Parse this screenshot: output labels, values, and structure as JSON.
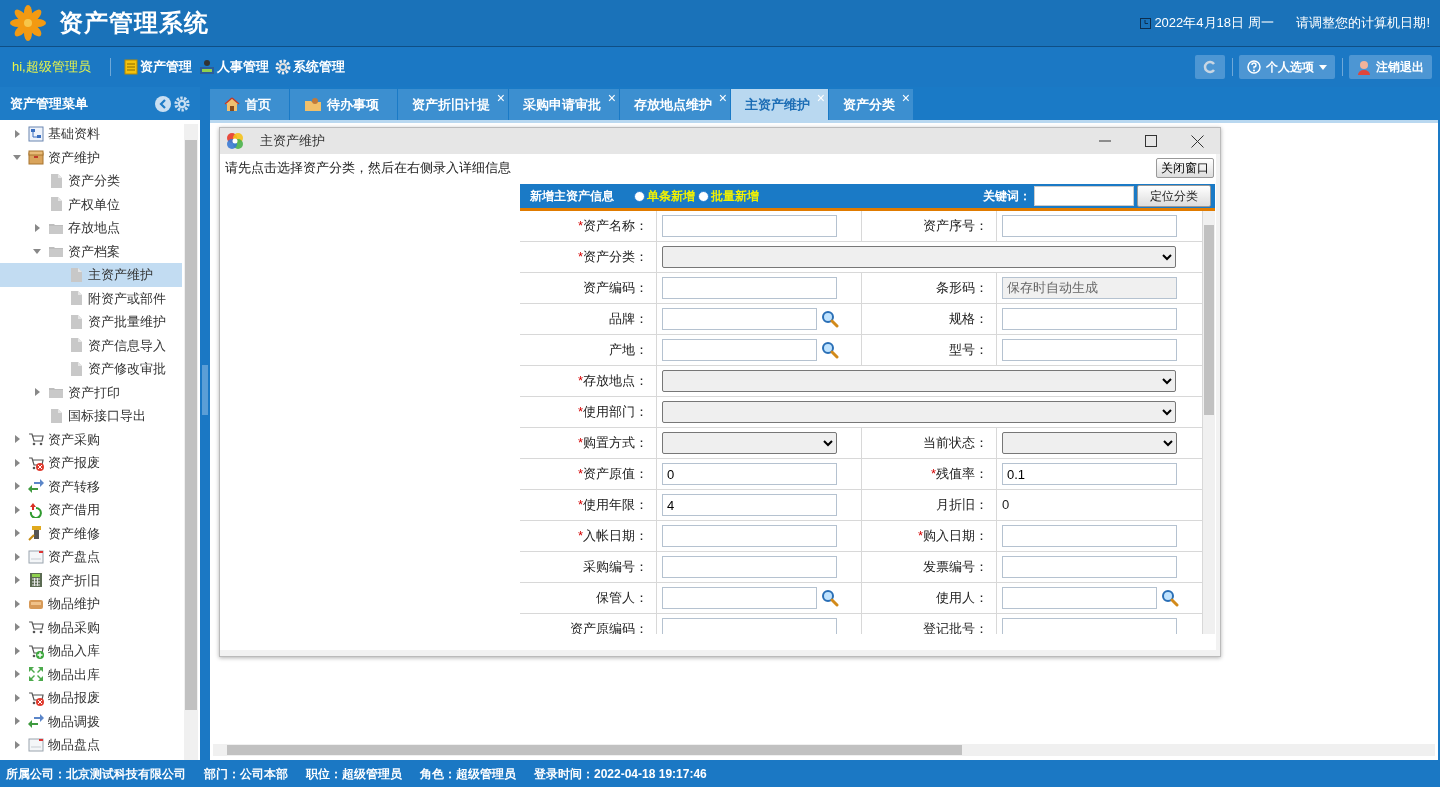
{
  "header": {
    "title": "资产管理系统",
    "date": "2022年4月18日 周一",
    "notice": "请调整您的计算机日期!"
  },
  "navbar": {
    "greeting": "hi,超级管理员",
    "menus": [
      "资产管理",
      "人事管理",
      "系统管理"
    ],
    "options": "个人选项",
    "logout": "注销退出"
  },
  "sidebar": {
    "title": "资产管理菜单",
    "items": [
      {
        "label": "基础资料",
        "expanded": false,
        "selected": false
      },
      {
        "label": "资产维护",
        "expanded": true,
        "selected": false,
        "children": [
          {
            "label": "资产分类",
            "selected": false
          },
          {
            "label": "产权单位",
            "selected": false
          },
          {
            "label": "存放地点",
            "expanded": false,
            "selected": false
          },
          {
            "label": "资产档案",
            "expanded": true,
            "selected": false,
            "children": [
              {
                "label": "主资产维护",
                "selected": true
              },
              {
                "label": "附资产或部件",
                "selected": false
              },
              {
                "label": "资产批量维护",
                "selected": false
              },
              {
                "label": "资产信息导入",
                "selected": false
              },
              {
                "label": "资产修改审批",
                "selected": false
              }
            ]
          },
          {
            "label": "资产打印",
            "expanded": false,
            "selected": false
          },
          {
            "label": "国标接口导出",
            "selected": false
          }
        ]
      },
      {
        "label": "资产采购",
        "expanded": false,
        "selected": false
      },
      {
        "label": "资产报废",
        "expanded": false,
        "selected": false
      },
      {
        "label": "资产转移",
        "expanded": false,
        "selected": false
      },
      {
        "label": "资产借用",
        "expanded": false,
        "selected": false
      },
      {
        "label": "资产维修",
        "expanded": false,
        "selected": false
      },
      {
        "label": "资产盘点",
        "expanded": false,
        "selected": false
      },
      {
        "label": "资产折旧",
        "expanded": false,
        "selected": false
      },
      {
        "label": "物品维护",
        "expanded": false,
        "selected": false
      },
      {
        "label": "物品采购",
        "expanded": false,
        "selected": false
      },
      {
        "label": "物品入库",
        "expanded": false,
        "selected": false
      },
      {
        "label": "物品出库",
        "expanded": false,
        "selected": false
      },
      {
        "label": "物品报废",
        "expanded": false,
        "selected": false
      },
      {
        "label": "物品调拨",
        "expanded": false,
        "selected": false
      },
      {
        "label": "物品盘点",
        "expanded": false,
        "selected": false
      }
    ]
  },
  "tabs": [
    {
      "label": "首页",
      "selected": false
    },
    {
      "label": "待办事项",
      "selected": false
    },
    {
      "label": "资产折旧计提",
      "selected": false,
      "close": "×"
    },
    {
      "label": "采购申请审批",
      "selected": false,
      "close": "×"
    },
    {
      "label": "存放地点维护",
      "selected": false,
      "close": "×"
    },
    {
      "label": "主资产维护",
      "selected": true,
      "close": "×"
    },
    {
      "label": "资产分类",
      "selected": false,
      "close": "×"
    }
  ],
  "dialog": {
    "title": "主资产维护",
    "hint": "请先点击选择资产分类，然后在右侧录入详细信息",
    "close_button": "关闭窗口",
    "form": {
      "title": "新增主资产信息",
      "modes": [
        {
          "label": "单条新增",
          "selected": false
        },
        {
          "label": "批量新增",
          "selected": false
        }
      ],
      "keyword_label": "关键词：",
      "locate_button": "定位分类",
      "rows": [
        {
          "kind": "pair",
          "cells": [
            {
              "mark": "*",
              "label": "资产名称：",
              "kind": "text"
            },
            {
              "label": "资产序号：",
              "kind": "text"
            }
          ]
        },
        {
          "kind": "full",
          "cells": [
            {
              "mark": "*",
              "label": "资产分类：",
              "kind": "select"
            }
          ]
        },
        {
          "kind": "pair",
          "cells": [
            {
              "label": "资产编码：",
              "kind": "text"
            },
            {
              "label": "条形码：",
              "kind": "readonly",
              "value": "保存时自动生成"
            }
          ]
        },
        {
          "kind": "pair",
          "cells": [
            {
              "label": "品牌：",
              "kind": "lookup"
            },
            {
              "label": "规格：",
              "kind": "text"
            }
          ]
        },
        {
          "kind": "pair",
          "cells": [
            {
              "label": "产地：",
              "kind": "lookup"
            },
            {
              "label": "型号：",
              "kind": "text"
            }
          ]
        },
        {
          "kind": "full",
          "cells": [
            {
              "mark": "*",
              "label": "存放地点：",
              "kind": "select"
            }
          ]
        },
        {
          "kind": "full",
          "cells": [
            {
              "mark": "*",
              "label": "使用部门：",
              "kind": "select"
            }
          ]
        },
        {
          "kind": "pair",
          "cells": [
            {
              "mark": "*",
              "label": "购置方式：",
              "kind": "select"
            },
            {
              "label": "当前状态：",
              "kind": "select"
            }
          ]
        },
        {
          "kind": "pair",
          "cells": [
            {
              "mark": "*",
              "label": "资产原值：",
              "kind": "text",
              "value": "0"
            },
            {
              "mark": "*",
              "label": "残值率：",
              "kind": "text",
              "value": "0.1"
            }
          ]
        },
        {
          "kind": "pair",
          "cells": [
            {
              "mark": "*",
              "label": "使用年限：",
              "kind": "text",
              "value": "4"
            },
            {
              "label": "月折旧：",
              "kind": "plain",
              "value": "0"
            }
          ]
        },
        {
          "kind": "pair",
          "cells": [
            {
              "mark": "*",
              "label": "入帐日期：",
              "kind": "text"
            },
            {
              "mark": "*",
              "label": "购入日期：",
              "kind": "text"
            }
          ]
        },
        {
          "kind": "pair",
          "cells": [
            {
              "label": "采购编号：",
              "kind": "text"
            },
            {
              "label": "发票编号：",
              "kind": "text"
            }
          ]
        },
        {
          "kind": "pair",
          "cells": [
            {
              "label": "保管人：",
              "kind": "lookup"
            },
            {
              "label": "使用人：",
              "kind": "lookup"
            }
          ]
        },
        {
          "kind": "pair",
          "cells": [
            {
              "label": "资产原编码：",
              "kind": "text"
            },
            {
              "label": "登记批号：",
              "kind": "text"
            }
          ]
        }
      ]
    }
  },
  "status_bar": [
    "所属公司：北京测试科技有限公司",
    "部门：公司本部",
    "职位：超级管理员",
    "角色：超级管理员",
    "登录时间：2022-04-18 19:17:46"
  ]
}
